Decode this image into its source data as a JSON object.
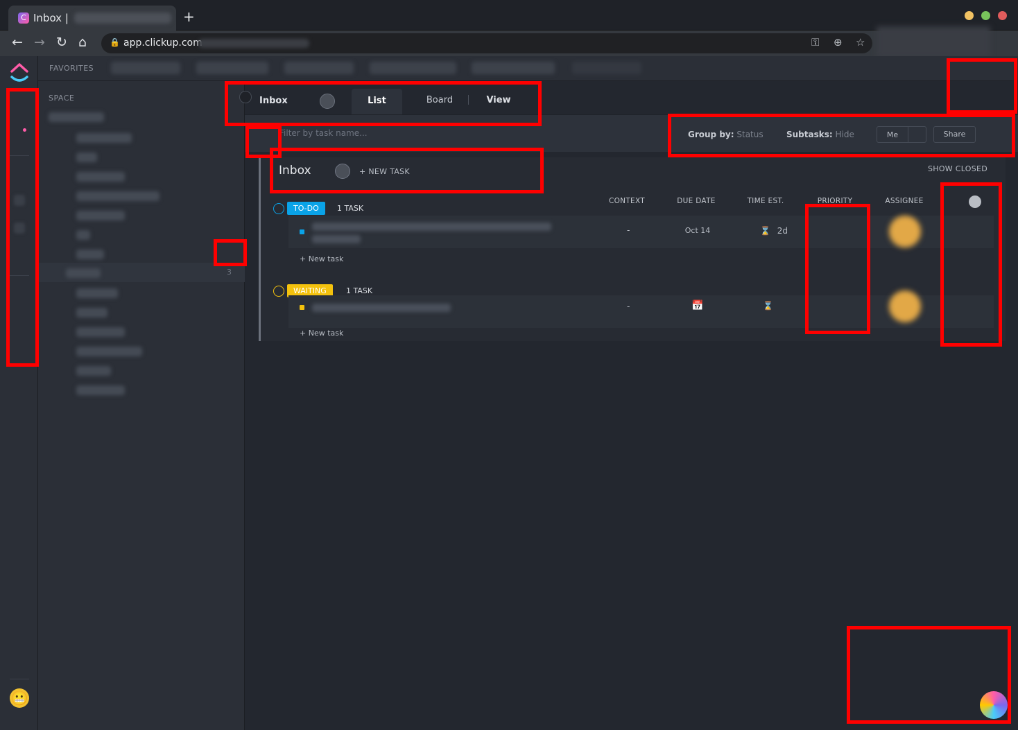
{
  "browser": {
    "tab_title": "Inbox |",
    "url": "app.clickup.com",
    "new_tab_symbol": "+",
    "window_dots": [
      "#f1c263",
      "#78c35b",
      "#e05c5c"
    ]
  },
  "favorites": {
    "label": "FAVORITES"
  },
  "sidebar": {
    "space_label": "SPACE",
    "count": "3"
  },
  "view": {
    "list_name": "Inbox",
    "tabs": [
      {
        "label": "List",
        "active": true
      },
      {
        "label": "Board",
        "active": false
      },
      {
        "label": "View",
        "active": false
      }
    ]
  },
  "filterbar": {
    "placeholder": "Filter by task name...",
    "group_by_label": "Group by:",
    "group_by_value": "Status",
    "subtasks_label": "Subtasks:",
    "subtasks_value": "Hide",
    "me_label": "Me",
    "share_label": "Share"
  },
  "list": {
    "title": "Inbox",
    "new_task": "+ NEW TASK",
    "show_closed": "SHOW CLOSED",
    "columns": [
      "CONTEXT",
      "DUE DATE",
      "TIME EST.",
      "PRIORITY",
      "ASSIGNEE"
    ],
    "groups": [
      {
        "status": "TO-DO",
        "color": "#0aa3e8",
        "count": "1 TASK",
        "tasks": [
          {
            "context": "-",
            "due_date": "Oct 14",
            "time_est": "2d"
          }
        ],
        "new_task_link": "+ New task"
      },
      {
        "status": "WAITING",
        "color": "#f4c20d",
        "count": "1 TASK",
        "tasks": [
          {
            "context": "-",
            "due_date": "",
            "time_est": ""
          }
        ],
        "new_task_link": "+ New task"
      }
    ]
  },
  "icons": {
    "hourglass": "hourglass-icon",
    "calendar": "calendar-icon",
    "lock": "lock-icon"
  }
}
